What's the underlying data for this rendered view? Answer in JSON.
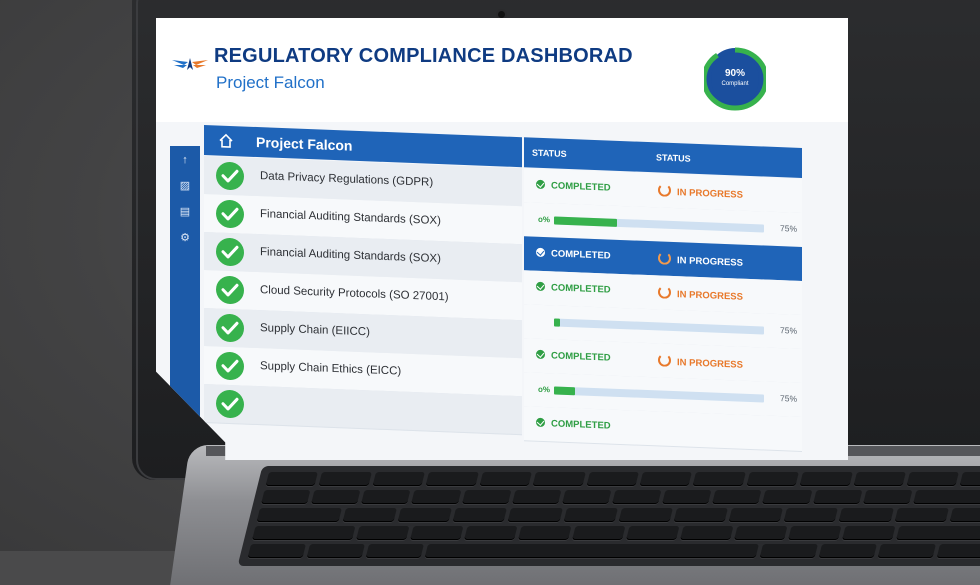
{
  "header": {
    "title": "REGULATORY COMPLIANCE DASHBORAD",
    "subtitle": "Project Falcon"
  },
  "gauge": {
    "value_label": "90%",
    "caption": "Compliant",
    "fraction": 0.9
  },
  "table": {
    "section_title": "Project Falcon",
    "status_header_1": "STATUS",
    "status_header_2": "STATUS",
    "rows": [
      {
        "label": "Data Privacy Regulations (GDPR)"
      },
      {
        "label": "Financial Auditing Standards (SOX)"
      },
      {
        "label": "Financial Auditing Standards (SOX)"
      },
      {
        "label": "Cloud Security Protocols (SO 27001)"
      },
      {
        "label": "Supply Chain (EIICC)"
      },
      {
        "label": "Supply Chain Ethics (EICC)"
      },
      {
        "label": ""
      }
    ],
    "status_rows": [
      {
        "completed": "COMPLETED",
        "progress": "IN PROGRESS"
      },
      {
        "lead": "o%",
        "fill": 0.3,
        "percent": "75%"
      },
      {
        "completed": "COMPLETED",
        "progress": "IN PROGRESS"
      },
      {
        "completed": "COMPLETED",
        "progress": "IN PROGRESS"
      },
      {
        "lead": "",
        "fill": 0.03,
        "percent": "75%"
      },
      {
        "completed": "COMPLETED",
        "progress": "IN PROGRESS"
      },
      {
        "lead": "o%",
        "fill": 0.1,
        "percent": "75%"
      },
      {
        "completed": "COMPLETED",
        "progress": ""
      }
    ]
  },
  "colors": {
    "brand_blue": "#1f64b8",
    "title_blue": "#0f3b82",
    "success_green": "#37b24d",
    "progress_orange": "#e8792b"
  },
  "icons": [
    "logo-wing-icon",
    "home-icon",
    "upload-icon",
    "chart-icon",
    "document-icon",
    "settings-icon",
    "check-icon",
    "progress-ring-icon"
  ]
}
